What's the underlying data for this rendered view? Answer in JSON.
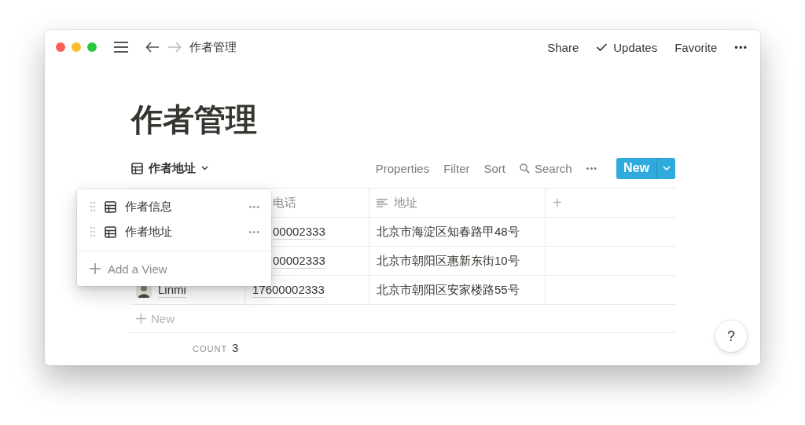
{
  "topbar": {
    "breadcrumb": "作者管理",
    "actions": [
      {
        "label": "Share",
        "kind": "text"
      },
      {
        "label": "Updates",
        "kind": "check"
      },
      {
        "label": "Favorite",
        "kind": "text"
      },
      {
        "label": "•••",
        "kind": "more"
      }
    ]
  },
  "page": {
    "title": "作者管理"
  },
  "view": {
    "name": "作者地址",
    "toolbar": [
      "Properties",
      "Filter",
      "Sort"
    ],
    "search": "Search",
    "more": "•••",
    "new_button": "New"
  },
  "table": {
    "columns": [
      {
        "label": "电话"
      },
      {
        "label": "地址"
      },
      {
        "label": "+"
      }
    ],
    "rows": [
      {
        "phone": "00002333",
        "address": "北京市海淀区知春路甲48号"
      },
      {
        "phone": "00002333",
        "address": "北京市朝阳区惠新东街10号"
      },
      {
        "name": "Linmi",
        "phone": "17600002333",
        "address": "北京市朝阳区安家楼路55号"
      }
    ],
    "new_row": "New",
    "count_label": "COUNT",
    "count": "3"
  },
  "view_menu": {
    "items": [
      {
        "label": "作者信息",
        "more": "•••"
      },
      {
        "label": "作者地址",
        "more": "•••"
      }
    ],
    "add": "Add a View"
  },
  "help": "?"
}
